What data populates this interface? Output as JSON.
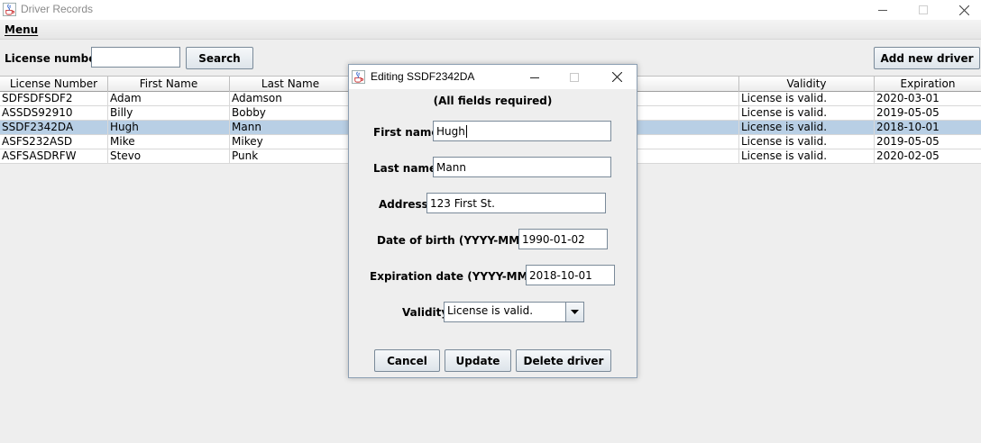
{
  "window": {
    "title": "Driver Records",
    "menu": "Menu"
  },
  "toolbar": {
    "license_label": "License number",
    "license_value": "",
    "search_label": "Search",
    "add_label": "Add new driver"
  },
  "table": {
    "columns": [
      "License Number",
      "First Name",
      "Last Name",
      "",
      "Validity",
      "Expiration"
    ],
    "rows": [
      [
        "SDFSDFSDF2",
        "Adam",
        "Adamson",
        "",
        "License is valid.",
        "2020-03-01"
      ],
      [
        "ASSDS92910",
        "Billy",
        "Bobby",
        "",
        "License is valid.",
        "2019-05-05"
      ],
      [
        "SSDF2342DA",
        "Hugh",
        "Mann",
        "",
        "License is valid.",
        "2018-10-01"
      ],
      [
        "ASFS232ASD",
        "Mike",
        "Mikey",
        "",
        "License is valid.",
        "2019-05-05"
      ],
      [
        "ASFSASDRFW",
        "Stevo",
        "Punk",
        "",
        "License is valid.",
        "2020-02-05"
      ]
    ],
    "selected_row": 2
  },
  "dialog": {
    "title": "Editing SSDF2342DA",
    "note": "(All fields required)",
    "first_name_label": "First name",
    "first_name_value": "Hugh",
    "last_name_label": "Last name",
    "last_name_value": "Mann",
    "address_label": "Address",
    "address_value": "123 First St.",
    "dob_label": "Date of birth (YYYY-MM-DD)",
    "dob_value": "1990-01-02",
    "exp_label": "Expiration date (YYYY-MM-DD)",
    "exp_value": "2018-10-01",
    "validity_label": "Validity",
    "validity_value": "License is valid.",
    "cancel_label": "Cancel",
    "update_label": "Update",
    "delete_label": "Delete driver"
  },
  "icons": [
    "java-cup-icon",
    "minimize-icon",
    "maximize-icon",
    "close-icon",
    "chevron-down-icon"
  ],
  "colors": {
    "selection": "#b8cfe5",
    "background": "#eeeeee",
    "border": "#7a8a99"
  }
}
